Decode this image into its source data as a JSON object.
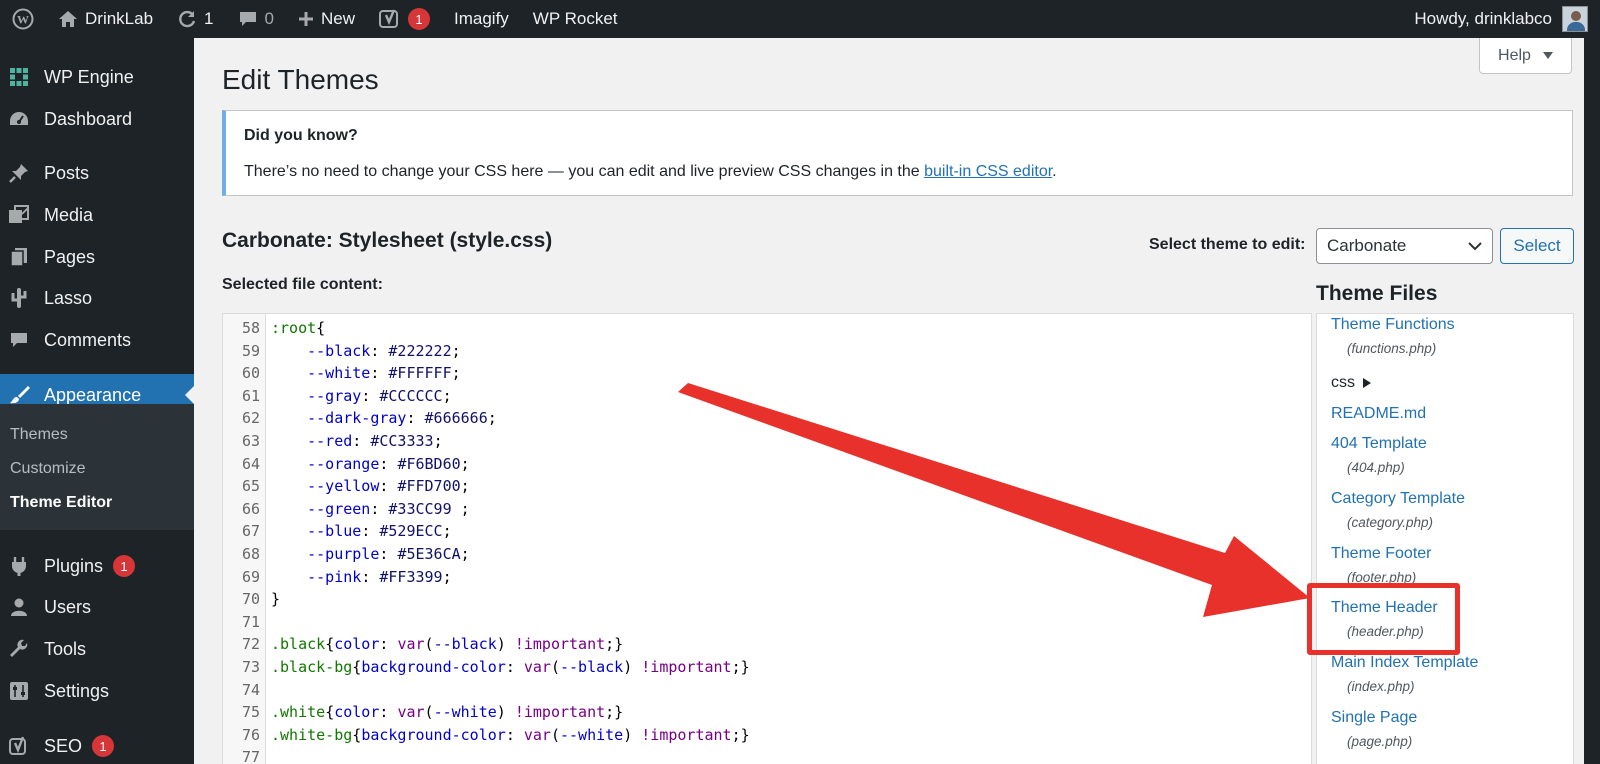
{
  "adminbar": {
    "site_name": "DrinkLab",
    "updates_count": "1",
    "comments_count": "0",
    "new_label": "New",
    "yoast_badge": "1",
    "imagify_label": "Imagify",
    "wprocket_label": "WP Rocket",
    "howdy": "Howdy, drinklabco"
  },
  "menu": {
    "items": [
      {
        "label": "WP Engine",
        "icon": "grid-icon"
      },
      {
        "label": "Dashboard",
        "icon": "dashboard-icon"
      },
      {
        "label": "Posts",
        "icon": "pin-icon"
      },
      {
        "label": "Media",
        "icon": "media-icon"
      },
      {
        "label": "Pages",
        "icon": "pages-icon"
      },
      {
        "label": "Lasso",
        "icon": "cactus-icon"
      },
      {
        "label": "Comments",
        "icon": "comment-icon"
      },
      {
        "label": "Appearance",
        "icon": "brush-icon"
      },
      {
        "label": "Plugins",
        "icon": "plugin-icon",
        "badge": "1"
      },
      {
        "label": "Users",
        "icon": "user-icon"
      },
      {
        "label": "Tools",
        "icon": "wrench-icon"
      },
      {
        "label": "Settings",
        "icon": "settings-icon"
      },
      {
        "label": "SEO",
        "icon": "yoast-icon",
        "badge": "1"
      }
    ],
    "submenu": [
      "Themes",
      "Customize",
      "Theme Editor"
    ]
  },
  "help_label": "Help",
  "page_title": "Edit Themes",
  "notice": {
    "title": "Did you know?",
    "text_before": "There’s no need to change your CSS here — you can edit and live preview CSS changes in the ",
    "link": "built-in CSS editor",
    "text_after": "."
  },
  "file_title": "Carbonate: Stylesheet (style.css)",
  "select_label": "Select theme to edit:",
  "selected_theme": "Carbonate",
  "select_button": "Select",
  "content_label": "Selected file content:",
  "code_lines": [
    {
      "n": "58",
      "parts": [
        [
          ":root",
          "sel"
        ],
        [
          "{",
          "txt"
        ]
      ]
    },
    {
      "n": "59",
      "parts": [
        [
          "    --black",
          "prop"
        ],
        [
          ": ",
          "txt"
        ],
        [
          "#222222",
          "num"
        ],
        [
          ";",
          "txt"
        ]
      ]
    },
    {
      "n": "60",
      "parts": [
        [
          "    --white",
          "prop"
        ],
        [
          ": ",
          "txt"
        ],
        [
          "#FFFFFF",
          "num"
        ],
        [
          ";",
          "txt"
        ]
      ]
    },
    {
      "n": "61",
      "parts": [
        [
          "    --gray",
          "prop"
        ],
        [
          ": ",
          "txt"
        ],
        [
          "#CCCCCC",
          "num"
        ],
        [
          ";",
          "txt"
        ]
      ]
    },
    {
      "n": "62",
      "parts": [
        [
          "    --dark-gray",
          "prop"
        ],
        [
          ": ",
          "txt"
        ],
        [
          "#666666",
          "num"
        ],
        [
          ";",
          "txt"
        ]
      ]
    },
    {
      "n": "63",
      "parts": [
        [
          "    --red",
          "prop"
        ],
        [
          ": ",
          "txt"
        ],
        [
          "#CC3333",
          "num"
        ],
        [
          ";",
          "txt"
        ]
      ]
    },
    {
      "n": "64",
      "parts": [
        [
          "    --orange",
          "prop"
        ],
        [
          ": ",
          "txt"
        ],
        [
          "#F6BD60",
          "num"
        ],
        [
          ";",
          "txt"
        ]
      ]
    },
    {
      "n": "65",
      "parts": [
        [
          "    --yellow",
          "prop"
        ],
        [
          ": ",
          "txt"
        ],
        [
          "#FFD700",
          "num"
        ],
        [
          ";",
          "txt"
        ]
      ]
    },
    {
      "n": "66",
      "parts": [
        [
          "    --green",
          "prop"
        ],
        [
          ": ",
          "txt"
        ],
        [
          "#33CC99",
          "num"
        ],
        [
          " ;",
          "txt"
        ]
      ]
    },
    {
      "n": "67",
      "parts": [
        [
          "    --blue",
          "prop"
        ],
        [
          ": ",
          "txt"
        ],
        [
          "#529ECC",
          "num"
        ],
        [
          ";",
          "txt"
        ]
      ]
    },
    {
      "n": "68",
      "parts": [
        [
          "    --purple",
          "prop"
        ],
        [
          ": ",
          "txt"
        ],
        [
          "#5E36CA",
          "num"
        ],
        [
          ";",
          "txt"
        ]
      ]
    },
    {
      "n": "69",
      "parts": [
        [
          "    --pink",
          "prop"
        ],
        [
          ": ",
          "txt"
        ],
        [
          "#FF3399",
          "num"
        ],
        [
          ";",
          "txt"
        ]
      ]
    },
    {
      "n": "70",
      "parts": [
        [
          "}",
          "txt"
        ]
      ]
    },
    {
      "n": "71",
      "parts": []
    },
    {
      "n": "72",
      "parts": [
        [
          ".black",
          "sel"
        ],
        [
          "{",
          "txt"
        ],
        [
          "color",
          "prop"
        ],
        [
          ": ",
          "txt"
        ],
        [
          "var",
          "kw"
        ],
        [
          "(",
          "txt"
        ],
        [
          "--black",
          "prop"
        ],
        [
          ") ",
          "txt"
        ],
        [
          "!important",
          "kw"
        ],
        [
          ";}",
          "txt"
        ]
      ]
    },
    {
      "n": "73",
      "parts": [
        [
          ".black-bg",
          "sel"
        ],
        [
          "{",
          "txt"
        ],
        [
          "background-color",
          "prop"
        ],
        [
          ": ",
          "txt"
        ],
        [
          "var",
          "kw"
        ],
        [
          "(",
          "txt"
        ],
        [
          "--black",
          "prop"
        ],
        [
          ") ",
          "txt"
        ],
        [
          "!important",
          "kw"
        ],
        [
          ";}",
          "txt"
        ]
      ]
    },
    {
      "n": "74",
      "parts": []
    },
    {
      "n": "75",
      "parts": [
        [
          ".white",
          "sel"
        ],
        [
          "{",
          "txt"
        ],
        [
          "color",
          "prop"
        ],
        [
          ": ",
          "txt"
        ],
        [
          "var",
          "kw"
        ],
        [
          "(",
          "txt"
        ],
        [
          "--white",
          "prop"
        ],
        [
          ") ",
          "txt"
        ],
        [
          "!important",
          "kw"
        ],
        [
          ";}",
          "txt"
        ]
      ]
    },
    {
      "n": "76",
      "parts": [
        [
          ".white-bg",
          "sel"
        ],
        [
          "{",
          "txt"
        ],
        [
          "background-color",
          "prop"
        ],
        [
          ": ",
          "txt"
        ],
        [
          "var",
          "kw"
        ],
        [
          "(",
          "txt"
        ],
        [
          "--white",
          "prop"
        ],
        [
          ") ",
          "txt"
        ],
        [
          "!important",
          "kw"
        ],
        [
          ";}",
          "txt"
        ]
      ]
    },
    {
      "n": "77",
      "parts": []
    }
  ],
  "theme_files": {
    "heading": "Theme Files",
    "entries": [
      {
        "label": "Theme Functions",
        "file": "(functions.php)"
      },
      {
        "folder": "css"
      },
      {
        "label": "README.md"
      },
      {
        "label": "404 Template",
        "file": "(404.php)"
      },
      {
        "label": "Category Template",
        "file": "(category.php)"
      },
      {
        "label": "Theme Footer",
        "file": "(footer.php)"
      },
      {
        "label": "Theme Header",
        "file": "(header.php)"
      },
      {
        "label": "Main Index Template",
        "file": "(index.php)"
      },
      {
        "label": "Single Page",
        "file": "(page.php)"
      }
    ]
  },
  "colors": {
    "admin_dark": "#1d2327",
    "accent_blue": "#2271b1",
    "badge_red": "#d63638",
    "annotation_red": "#e8312a",
    "notice_border": "#72aee6"
  }
}
